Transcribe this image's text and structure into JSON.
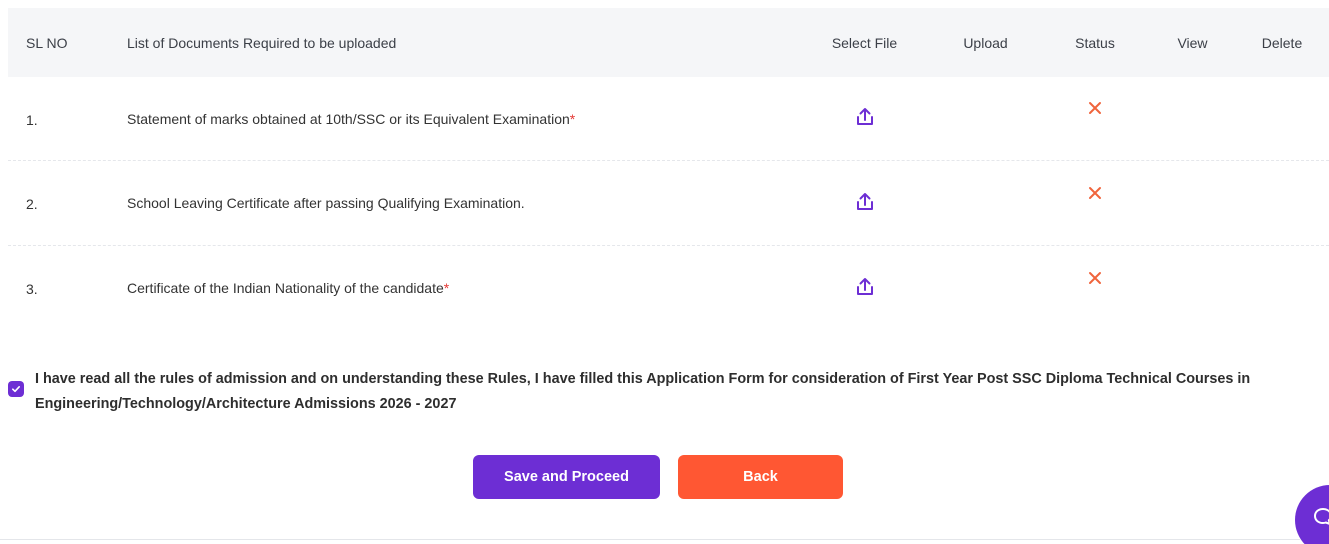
{
  "table": {
    "headers": {
      "sl_no": "SL NO",
      "documents": "List of Documents Required to be uploaded",
      "select_file": "Select File",
      "upload": "Upload",
      "status": "Status",
      "view": "View",
      "delete": "Delete"
    },
    "rows": [
      {
        "sl": "1.",
        "document": "Statement of marks obtained at 10th/SSC or its Equivalent Examination",
        "required_mark": "*",
        "status_icon": "cross-icon"
      },
      {
        "sl": "2.",
        "document": "School Leaving Certificate after passing Qualifying Examination.",
        "required_mark": "",
        "status_icon": "cross-icon"
      },
      {
        "sl": "3.",
        "document": "Certificate of the Indian Nationality of the candidate",
        "required_mark": "*",
        "status_icon": "cross-icon"
      }
    ]
  },
  "declaration": {
    "checked": true,
    "text": "I have read all the rules of admission and on understanding these Rules, I have filled this Application Form for consideration of First Year Post SSC Diploma Technical Courses in Engineering/Technology/Architecture Admissions 2026 - 2027"
  },
  "actions": {
    "save_label": "Save and Proceed",
    "back_label": "Back"
  },
  "colors": {
    "primary": "#6d2ed4",
    "back": "#ff5733",
    "status_cross": "#f0643c",
    "required": "#e53935",
    "header_bg": "#f5f6f8"
  },
  "icons": {
    "select_file": "upload-icon",
    "status": "cross-icon",
    "chat": "chat-icon",
    "checkbox": "check-icon"
  }
}
